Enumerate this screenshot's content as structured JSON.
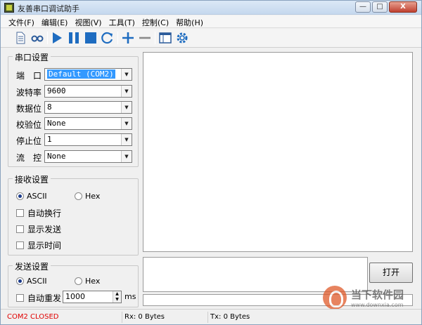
{
  "window": {
    "title": "友善串口调试助手",
    "buttons": [
      "—",
      "□",
      "X"
    ]
  },
  "menu": [
    "文件(F)",
    "编辑(E)",
    "视图(V)",
    "工具(T)",
    "控制(C)",
    "帮助(H)"
  ],
  "toolbar": {
    "icons": [
      "new-document-icon",
      "loop-icon",
      "play-icon",
      "pause-icon",
      "stop-icon",
      "refresh-icon",
      "add-icon",
      "remove-icon",
      "window-icon",
      "settings-gear-icon"
    ]
  },
  "serial": {
    "title": "串口设置",
    "fields": [
      {
        "label": "端　口",
        "value": "Default (COM2)"
      },
      {
        "label": "波特率",
        "value": "9600"
      },
      {
        "label": "数据位",
        "value": "8"
      },
      {
        "label": "校验位",
        "value": "None"
      },
      {
        "label": "停止位",
        "value": "1"
      },
      {
        "label": "流　控",
        "value": "None"
      }
    ]
  },
  "receive": {
    "title": "接收设置",
    "ascii": "ASCII",
    "hex": "Hex",
    "ascii_selected": true,
    "options": [
      "自动换行",
      "显示发送",
      "显示时间"
    ]
  },
  "send": {
    "title": "发送设置",
    "ascii": "ASCII",
    "hex": "Hex",
    "ascii_selected": true,
    "auto_resend_label": "自动重发",
    "interval": "1000",
    "unit": "ms",
    "open_button": "打开"
  },
  "status": {
    "port": "COM2 CLOSED",
    "rx": "Rx: 0 Bytes",
    "tx": "Tx: 0 Bytes",
    "port_color": "#e00000"
  },
  "watermark": {
    "name": "当下软件园",
    "url": "www.downxia.com"
  }
}
